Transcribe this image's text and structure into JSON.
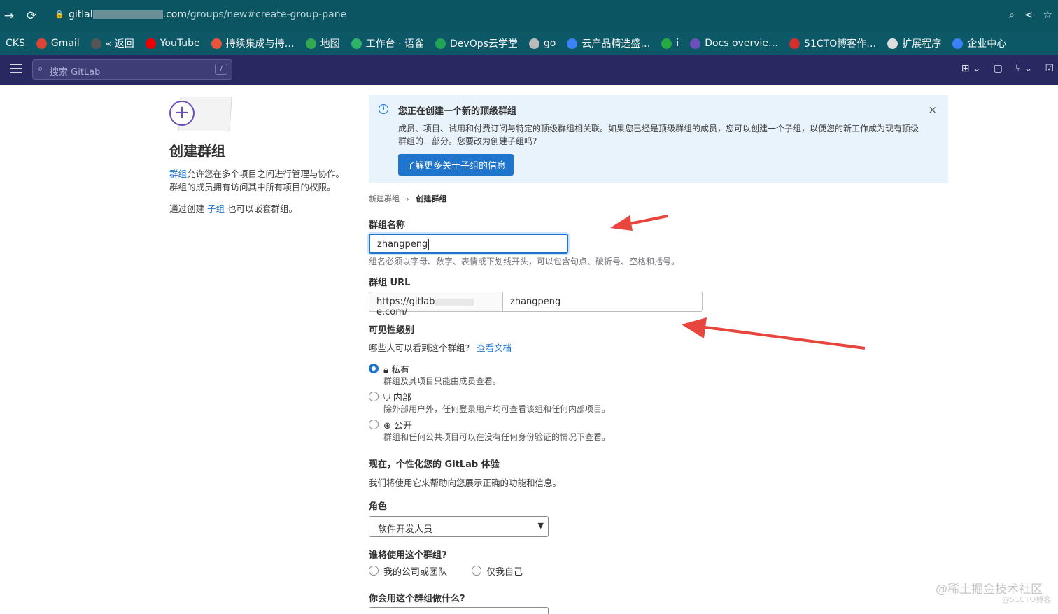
{
  "browser": {
    "url_prefix": "gitlal",
    "url_host_suffix": ".com",
    "url_path": "/groups/new#create-group-pane",
    "bookmarks": [
      {
        "label": "CKS",
        "icon": "none"
      },
      {
        "label": "Gmail",
        "icon": "google-icon"
      },
      {
        "label": "« 返回",
        "icon": "globe-icon"
      },
      {
        "label": "YouTube",
        "icon": "youtube-icon"
      },
      {
        "label": "持续集成与持…",
        "icon": "c-icon"
      },
      {
        "label": "地图",
        "icon": "maps-icon"
      },
      {
        "label": "工作台 · 语雀",
        "icon": "yuque-icon"
      },
      {
        "label": "DevOps云学堂",
        "icon": "devops-icon"
      },
      {
        "label": "go",
        "icon": "folder-icon"
      },
      {
        "label": "云产品精选盛…",
        "icon": "cloud-icon"
      },
      {
        "label": "i",
        "icon": "s-icon"
      },
      {
        "label": "Docs overvie…",
        "icon": "docs-icon"
      },
      {
        "label": "51CTO博客作…",
        "icon": "51cto-icon"
      },
      {
        "label": "扩展程序",
        "icon": "puzzle-icon"
      },
      {
        "label": "企业中心",
        "icon": "cloud-icon"
      }
    ]
  },
  "gitlab": {
    "search_placeholder": "搜索 GitLab",
    "search_shortcut": "/"
  },
  "left": {
    "title": "创建群组",
    "desc_link": "群组",
    "desc_rest": "允许您在多个项目之间进行管理与协作。群组的成员拥有访问其中所有项目的权限。",
    "nest_prefix": "通过创建 ",
    "nest_link": "子组",
    "nest_suffix": " 也可以嵌套群组。"
  },
  "alert": {
    "title": "您正在创建一个新的顶级群组",
    "body": "成员、项目、试用和付费订阅与特定的顶级群组相关联。如果您已经是顶级群组的成员，您可以创建一个子组，以便您的新工作成为现有顶级群组的一部分。您要改为创建子组吗?",
    "button": "了解更多关于子组的信息",
    "close": "×"
  },
  "breadcrumb": {
    "parent": "新建群组",
    "separator": "›",
    "current": "创建群组"
  },
  "form": {
    "name_label": "群组名称",
    "name_value": "zhangpeng",
    "name_help": "组名必须以字母、数字、表情或下划线开头，可以包含句点、破折号、空格和括号。",
    "url_label": "群组 URL",
    "url_prefix_start": "https://gitlab",
    "url_prefix_end": "e.com/",
    "url_value": "zhangpeng",
    "visibility_label": "可见性级别",
    "visibility_question": "哪些人可以看到这个群组?",
    "visibility_docs": "查看文档",
    "visibility_options": [
      {
        "icon": "lock-icon",
        "label": "私有",
        "desc": "群组及其项目只能由成员查看。",
        "selected": true
      },
      {
        "icon": "shield-icon",
        "label": "内部",
        "desc": "除外部用户外，任何登录用户均可查看该组和任何内部项目。",
        "selected": false
      },
      {
        "icon": "globe-icon",
        "label": "公开",
        "desc": "群组和任何公共项目可以在没有任何身份验证的情况下查看。",
        "selected": false
      }
    ],
    "personalize_title": "现在，个性化您的 GitLab 体验",
    "personalize_desc": "我们将使用它来帮助向您展示正确的功能和信息。",
    "role_label": "角色",
    "role_value": "软件开发人员",
    "who_label": "谁将使用这个群组?",
    "who_options": [
      {
        "label": "我的公司或团队",
        "selected": false
      },
      {
        "label": "仅我自己",
        "selected": false
      }
    ],
    "what_label": "你会用这个群组做什么?"
  },
  "watermark": {
    "line1": "@稀土掘金技术社区",
    "line2": "@51CTO博客"
  },
  "colors": {
    "browser": "#0b5563",
    "gitlab_nav": "#292961",
    "accent": "#1f75cb",
    "annotation_arrow": "#e8453c"
  }
}
